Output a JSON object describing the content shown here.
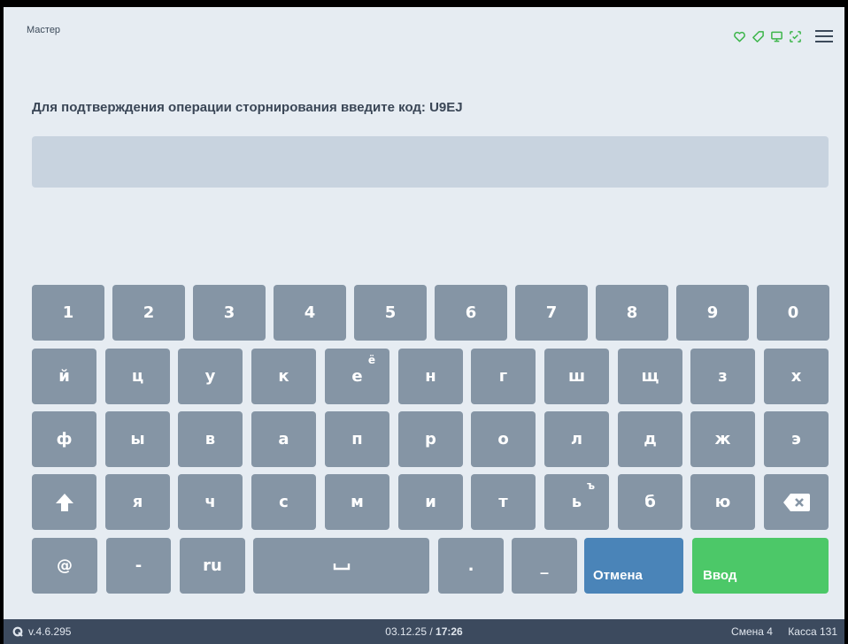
{
  "header": {
    "title": "Мастер",
    "icons": [
      "heart-icon",
      "tag-icon",
      "pos-terminal-icon",
      "scan-icon",
      "menu-icon"
    ],
    "accent_color": "#3cb54a"
  },
  "prompt": {
    "text": "Для подтверждения операции сторнирования введите код: U9EJ"
  },
  "code_input": {
    "value": "",
    "placeholder": ""
  },
  "keyboard": {
    "layout": "ru",
    "rows": [
      [
        {
          "label": "1",
          "name": "key-1"
        },
        {
          "label": "2",
          "name": "key-2"
        },
        {
          "label": "3",
          "name": "key-3"
        },
        {
          "label": "4",
          "name": "key-4"
        },
        {
          "label": "5",
          "name": "key-5"
        },
        {
          "label": "6",
          "name": "key-6"
        },
        {
          "label": "7",
          "name": "key-7"
        },
        {
          "label": "8",
          "name": "key-8"
        },
        {
          "label": "9",
          "name": "key-9"
        },
        {
          "label": "0",
          "name": "key-0"
        }
      ],
      [
        {
          "label": "й",
          "name": "key-y-short"
        },
        {
          "label": "ц",
          "name": "key-ts"
        },
        {
          "label": "у",
          "name": "key-u"
        },
        {
          "label": "к",
          "name": "key-k"
        },
        {
          "label": "е",
          "name": "key-e",
          "sup": "ё"
        },
        {
          "label": "н",
          "name": "key-n"
        },
        {
          "label": "г",
          "name": "key-g"
        },
        {
          "label": "ш",
          "name": "key-sh"
        },
        {
          "label": "щ",
          "name": "key-shch"
        },
        {
          "label": "з",
          "name": "key-z"
        },
        {
          "label": "х",
          "name": "key-kh"
        }
      ],
      [
        {
          "label": "ф",
          "name": "key-f"
        },
        {
          "label": "ы",
          "name": "key-y"
        },
        {
          "label": "в",
          "name": "key-v"
        },
        {
          "label": "а",
          "name": "key-a"
        },
        {
          "label": "п",
          "name": "key-p"
        },
        {
          "label": "р",
          "name": "key-r"
        },
        {
          "label": "о",
          "name": "key-o"
        },
        {
          "label": "л",
          "name": "key-l"
        },
        {
          "label": "д",
          "name": "key-d"
        },
        {
          "label": "ж",
          "name": "key-zh"
        },
        {
          "label": "э",
          "name": "key-eh"
        }
      ],
      [
        {
          "label": "",
          "name": "shift-key",
          "icon": "shift-arrow-icon"
        },
        {
          "label": "я",
          "name": "key-ya"
        },
        {
          "label": "ч",
          "name": "key-ch"
        },
        {
          "label": "с",
          "name": "key-s"
        },
        {
          "label": "м",
          "name": "key-m"
        },
        {
          "label": "и",
          "name": "key-i"
        },
        {
          "label": "т",
          "name": "key-t"
        },
        {
          "label": "ь",
          "name": "key-soft-sign",
          "sup": "ъ"
        },
        {
          "label": "б",
          "name": "key-b"
        },
        {
          "label": "ю",
          "name": "key-yu"
        },
        {
          "label": "",
          "name": "backspace-key",
          "icon": "backspace-icon"
        }
      ]
    ],
    "bottom": {
      "at": "@",
      "dash": "-",
      "lang": "ru",
      "space_symbol": "␣",
      "dot": ".",
      "underscore": "_",
      "cancel": "Отмена",
      "enter": "Ввод"
    }
  },
  "status_bar": {
    "version": "v.4.6.295",
    "date": "03.12.25 /",
    "time": "17:26",
    "shift": "Смена 4",
    "register": "Касса 131"
  }
}
